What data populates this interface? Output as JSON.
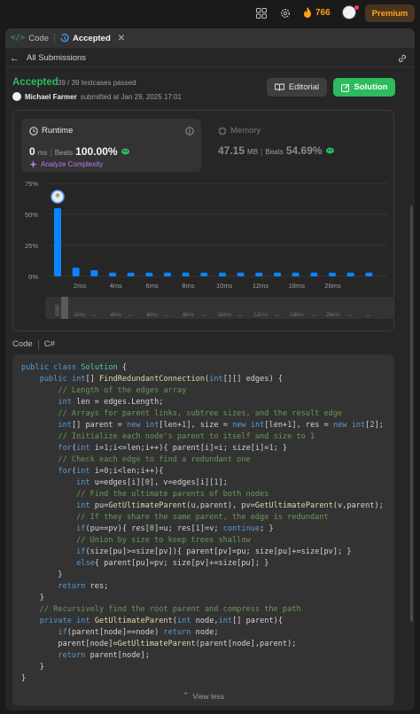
{
  "nav": {
    "streak_count": "766",
    "premium_label": "Premium"
  },
  "tabs": [
    {
      "label": "Code",
      "active": false
    },
    {
      "label": "Accepted",
      "active": true
    }
  ],
  "back_label": "All Submissions",
  "submission": {
    "status": "Accepted",
    "passed": "39 / 39 testcases passed",
    "author": "Michael Farmer",
    "submitted_at": "submitted at Jan 29, 2025 17:01",
    "editorial_label": "Editorial",
    "solution_label": "Solution"
  },
  "runtime": {
    "label": "Runtime",
    "value": "0",
    "unit": "ms",
    "beats_label": "Beats",
    "beats_value": "100.00%",
    "analyze_label": "Analyze Complexity"
  },
  "memory": {
    "label": "Memory",
    "value": "47.15",
    "unit": "MB",
    "beats_label": "Beats",
    "beats_value": "54.69%"
  },
  "chart_data": {
    "type": "bar",
    "y_ticks": [
      "75%",
      "50%",
      "25%",
      "0%"
    ],
    "ylim": [
      0,
      75
    ],
    "x_labels": [
      "2ms",
      "4ms",
      "6ms",
      "8ms",
      "10ms",
      "12ms",
      "18ms",
      "26ms"
    ],
    "values": [
      55,
      7,
      5,
      3,
      3,
      3,
      3,
      3,
      3,
      3,
      3,
      3,
      3,
      3,
      3,
      3,
      3,
      3
    ],
    "highlight_index": 0,
    "grid": true,
    "colors": {
      "bar": "#0a84ff",
      "grid": "#3c3c3c"
    }
  },
  "code_section": {
    "label": "Code",
    "language": "C#",
    "view_less_label": "View less",
    "lines": [
      "public class Solution {",
      "    public int[] FindRedundantConnection(int[][] edges) {",
      "        // Length of the edges array",
      "        int len = edges.Length;",
      "        // Arrays for parent links, subtree sizes, and the result edge",
      "        int[] parent = new int[len+1], size = new int[len+1], res = new int[2];",
      "        // Initialize each node's parent to itself and size to 1",
      "        for(int i=1;i<=len;i++){ parent[i]=i; size[i]=1; }",
      "        // Check each edge to find a redundant one",
      "        for(int i=0;i<len;i++){",
      "            int u=edges[i][0], v=edges[i][1];",
      "            // Find the ultimate parents of both nodes",
      "            int pu=GetUltimateParent(u,parent), pv=GetUltimateParent(v,parent);",
      "            // If they share the same parent, the edge is redundant",
      "            if(pu==pv){ res[0]=u; res[1]=v; continue; }",
      "            // Union by size to keep trees shallow",
      "            if(size[pu]>=size[pv]){ parent[pv]=pu; size[pu]+=size[pv]; }",
      "            else{ parent[pu]=pv; size[pv]+=size[pu]; }",
      "        }",
      "        return res;",
      "    }",
      "    // Recursively find the root parent and compress the path",
      "    private int GetUltimateParent(int node,int[] parent){",
      "        if(parent[node]==node) return node;",
      "        parent[node]=GetUltimateParent(parent[node],parent);",
      "        return parent[node];",
      "    }",
      "}"
    ]
  }
}
